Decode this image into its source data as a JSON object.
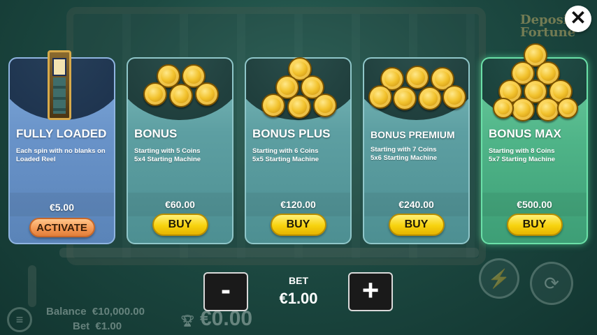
{
  "background": {
    "logo_text": "Deposit Fortune",
    "balance_label": "Balance",
    "balance_value": "€10,000.00",
    "bet_label": "Bet",
    "bet_value": "€1.00",
    "win_value": "€0.00"
  },
  "close_label": "✕",
  "cards": [
    {
      "title": "FULLY LOADED",
      "description": "Each spin with no blanks on Loaded Reel",
      "price": "€5.00",
      "button_label": "ACTIVATE",
      "style": "blue",
      "coin_count": 0
    },
    {
      "title": "BONUS",
      "line1": "Starting with 5 Coins",
      "line2": "5x4 Starting Machine",
      "price": "€60.00",
      "button_label": "BUY",
      "style": "teal",
      "coin_count": 5
    },
    {
      "title": "BONUS PLUS",
      "line1": "Starting with 6 Coins",
      "line2": "5x5 Starting Machine",
      "price": "€120.00",
      "button_label": "BUY",
      "style": "teal",
      "coin_count": 6
    },
    {
      "title": "BONUS PREMIUM",
      "line1": "Starting with 7 Coins",
      "line2": "5x6 Starting Machine",
      "price": "€240.00",
      "button_label": "BUY",
      "style": "teal",
      "coin_count": 7
    },
    {
      "title": "BONUS MAX",
      "line1": "Starting with 8 Coins",
      "line2": "5x7 Starting Machine",
      "price": "€500.00",
      "button_label": "BUY",
      "style": "green",
      "coin_count": 10
    }
  ],
  "bet_control": {
    "label": "BET",
    "value": "€1.00",
    "minus_label": "-",
    "plus_label": "+"
  },
  "icons": {
    "close": "close-icon",
    "minus": "minus-icon",
    "plus": "plus-icon",
    "menu": "menu-icon",
    "lightning": "lightning-icon",
    "autoplay": "autoplay-icon",
    "trophy": "trophy-icon"
  },
  "colors": {
    "buy_button": "#f7d20e",
    "activate_button": "#f59a55",
    "card_teal": "#5d9fa2",
    "card_blue": "#6892c8",
    "card_green": "#4fb488"
  }
}
